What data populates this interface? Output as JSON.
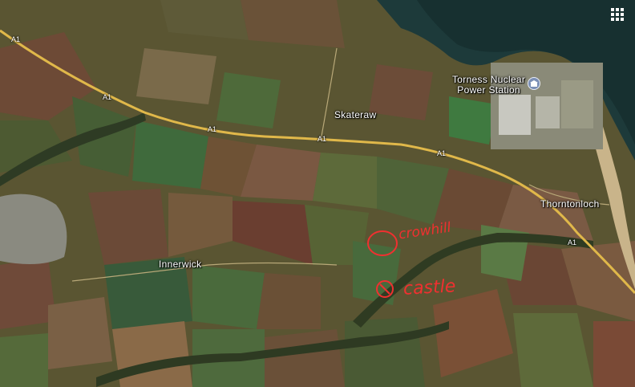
{
  "map": {
    "places": {
      "power_station_line1": "Torness Nuclear",
      "power_station_line2": "Power Station",
      "skateraw": "Skateraw",
      "thorntonloch": "Thorntonloch",
      "innerwick": "Innerwick"
    },
    "roads": {
      "a1_1": "A1",
      "a1_2": "A1",
      "a1_3": "A1",
      "a1_4": "A1",
      "a1_5": "A1"
    },
    "annotations": {
      "crowhill": "crowhill",
      "castle": "castle"
    },
    "icons": {
      "poi": "landmark-icon",
      "menu": "apps-grid-icon"
    },
    "colors": {
      "sea": "#1d3a3a",
      "road": "#e0b84a",
      "annotation": "#f03030"
    }
  }
}
